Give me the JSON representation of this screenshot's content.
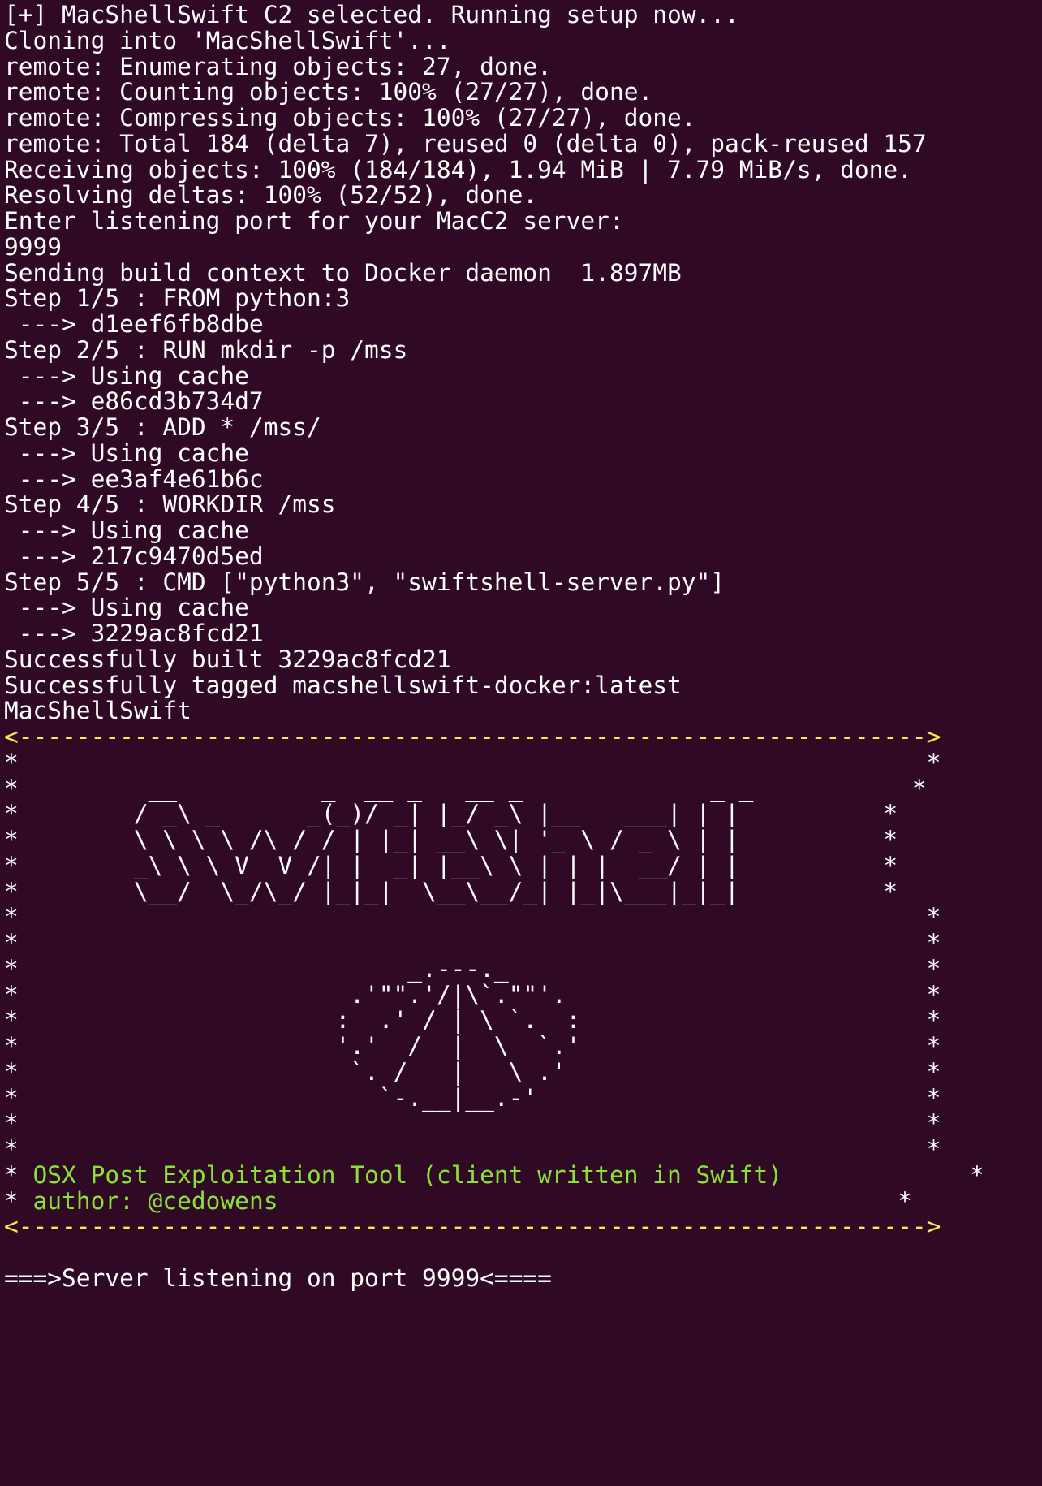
{
  "terminal": {
    "background": "#300a24",
    "foreground": "#ffffff",
    "colors": {
      "yellow": "#fce94f",
      "green": "#8ae234"
    },
    "setup_output": [
      "[+] MacShellSwift C2 selected. Running setup now...",
      "Cloning into 'MacShellSwift'...",
      "remote: Enumerating objects: 27, done.",
      "remote: Counting objects: 100% (27/27), done.",
      "remote: Compressing objects: 100% (27/27), done.",
      "remote: Total 184 (delta 7), reused 0 (delta 0), pack-reused 157",
      "Receiving objects: 100% (184/184), 1.94 MiB | 7.79 MiB/s, done.",
      "Resolving deltas: 100% (52/52), done.",
      "Enter listening port for your MacC2 server:",
      "9999",
      "Sending build context to Docker daemon  1.897MB",
      "Step 1/5 : FROM python:3",
      " ---> d1eef6fb8dbe",
      "Step 2/5 : RUN mkdir -p /mss",
      " ---> Using cache",
      " ---> e86cd3b734d7",
      "Step 3/5 : ADD * /mss/",
      " ---> Using cache",
      " ---> ee3af4e61b6c",
      "Step 4/5 : WORKDIR /mss",
      " ---> Using cache",
      " ---> 217c9470d5ed",
      "Step 5/5 : CMD [\"python3\", \"swiftshell-server.py\"]",
      " ---> Using cache",
      " ---> 3229ac8fcd21",
      "Successfully built 3229ac8fcd21",
      "Successfully tagged macshellswift-docker:latest",
      "MacShellSwift"
    ],
    "banner": {
      "border_top": "<--------------------------------------------------------------->",
      "border_bottom": "<--------------------------------------------------------------->",
      "art_lines": [
        "*                                                               *",
        "*         __          _  __ _   __ _             _ _           *",
        "*        / _\\ _      _(_)/ _| |_/ _\\ |__   ___| | |          *",
        "*        \\ \\ \\ \\ /\\ / / | |_| __\\ \\| '_ \\ / _ \\ | |          *",
        "*        _\\ \\ \\ V  V /| |  _| |__\\ \\ | | |  __/ | |          *",
        "*        \\__/  \\_/\\_/ |_|_|  \\__\\__/_| |_|\\___|_|_|          *",
        "*                                                               *",
        "*                                                               *",
        "*                           _.---._                             *",
        "*                       .'\"\".'/|\\`.\"\"'.                         *",
        "*                      :  .' / | \\ `.  :                        *",
        "*                      '.'  /  |  \\  `.'                        *",
        "*                       `. /   |   \\ .'                         *",
        "*                         `-.__|__.-'                           *",
        "*                                                               *",
        "*                                                               *"
      ],
      "description": "OSX Post Exploitation Tool (client written in Swift)",
      "author": "author: @cedowens",
      "star": "*",
      "description_pad": "             ",
      "author_pad": "                                           "
    },
    "status": "===>Server listening on port 9999<===="
  }
}
